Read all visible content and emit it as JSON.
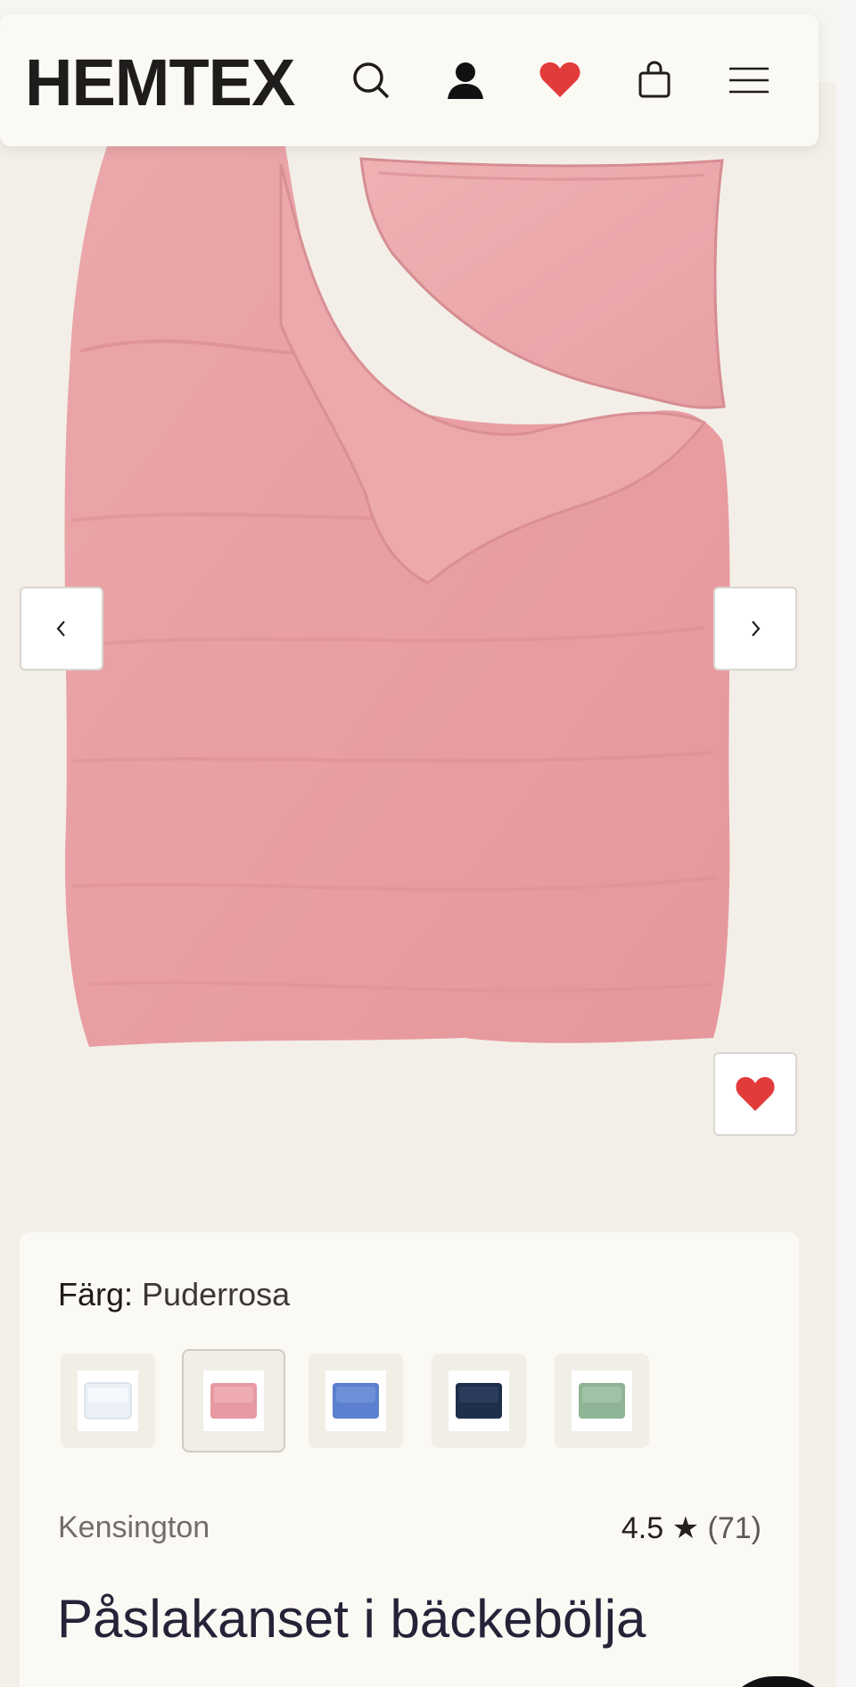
{
  "header": {
    "logo": "HEMTEX",
    "icons": [
      "search-icon",
      "account-icon",
      "wishlist-heart-icon",
      "shopping-bag-icon",
      "menu-icon"
    ]
  },
  "gallery": {
    "prev_icon": "chevron-left-icon",
    "next_icon": "chevron-right-icon",
    "favorite_icon": "heart-icon"
  },
  "product": {
    "color_label": "Färg:",
    "color_value": "Puderrosa",
    "swatches": [
      {
        "name": "white",
        "color": "#e8eef5"
      },
      {
        "name": "puderrosa",
        "color": "#e79aa3",
        "selected": true
      },
      {
        "name": "blue",
        "color": "#5a80cf"
      },
      {
        "name": "navy",
        "color": "#1f2e4a"
      },
      {
        "name": "green",
        "color": "#8fb596"
      }
    ],
    "brand": "Kensington",
    "rating_value": "4.5",
    "rating_star": "★",
    "rating_count": "(71)",
    "title": "Påslakanset i bäckebölja"
  },
  "colors": {
    "accent_red": "#e23b3b",
    "product_pink": "#e8a3a5"
  }
}
